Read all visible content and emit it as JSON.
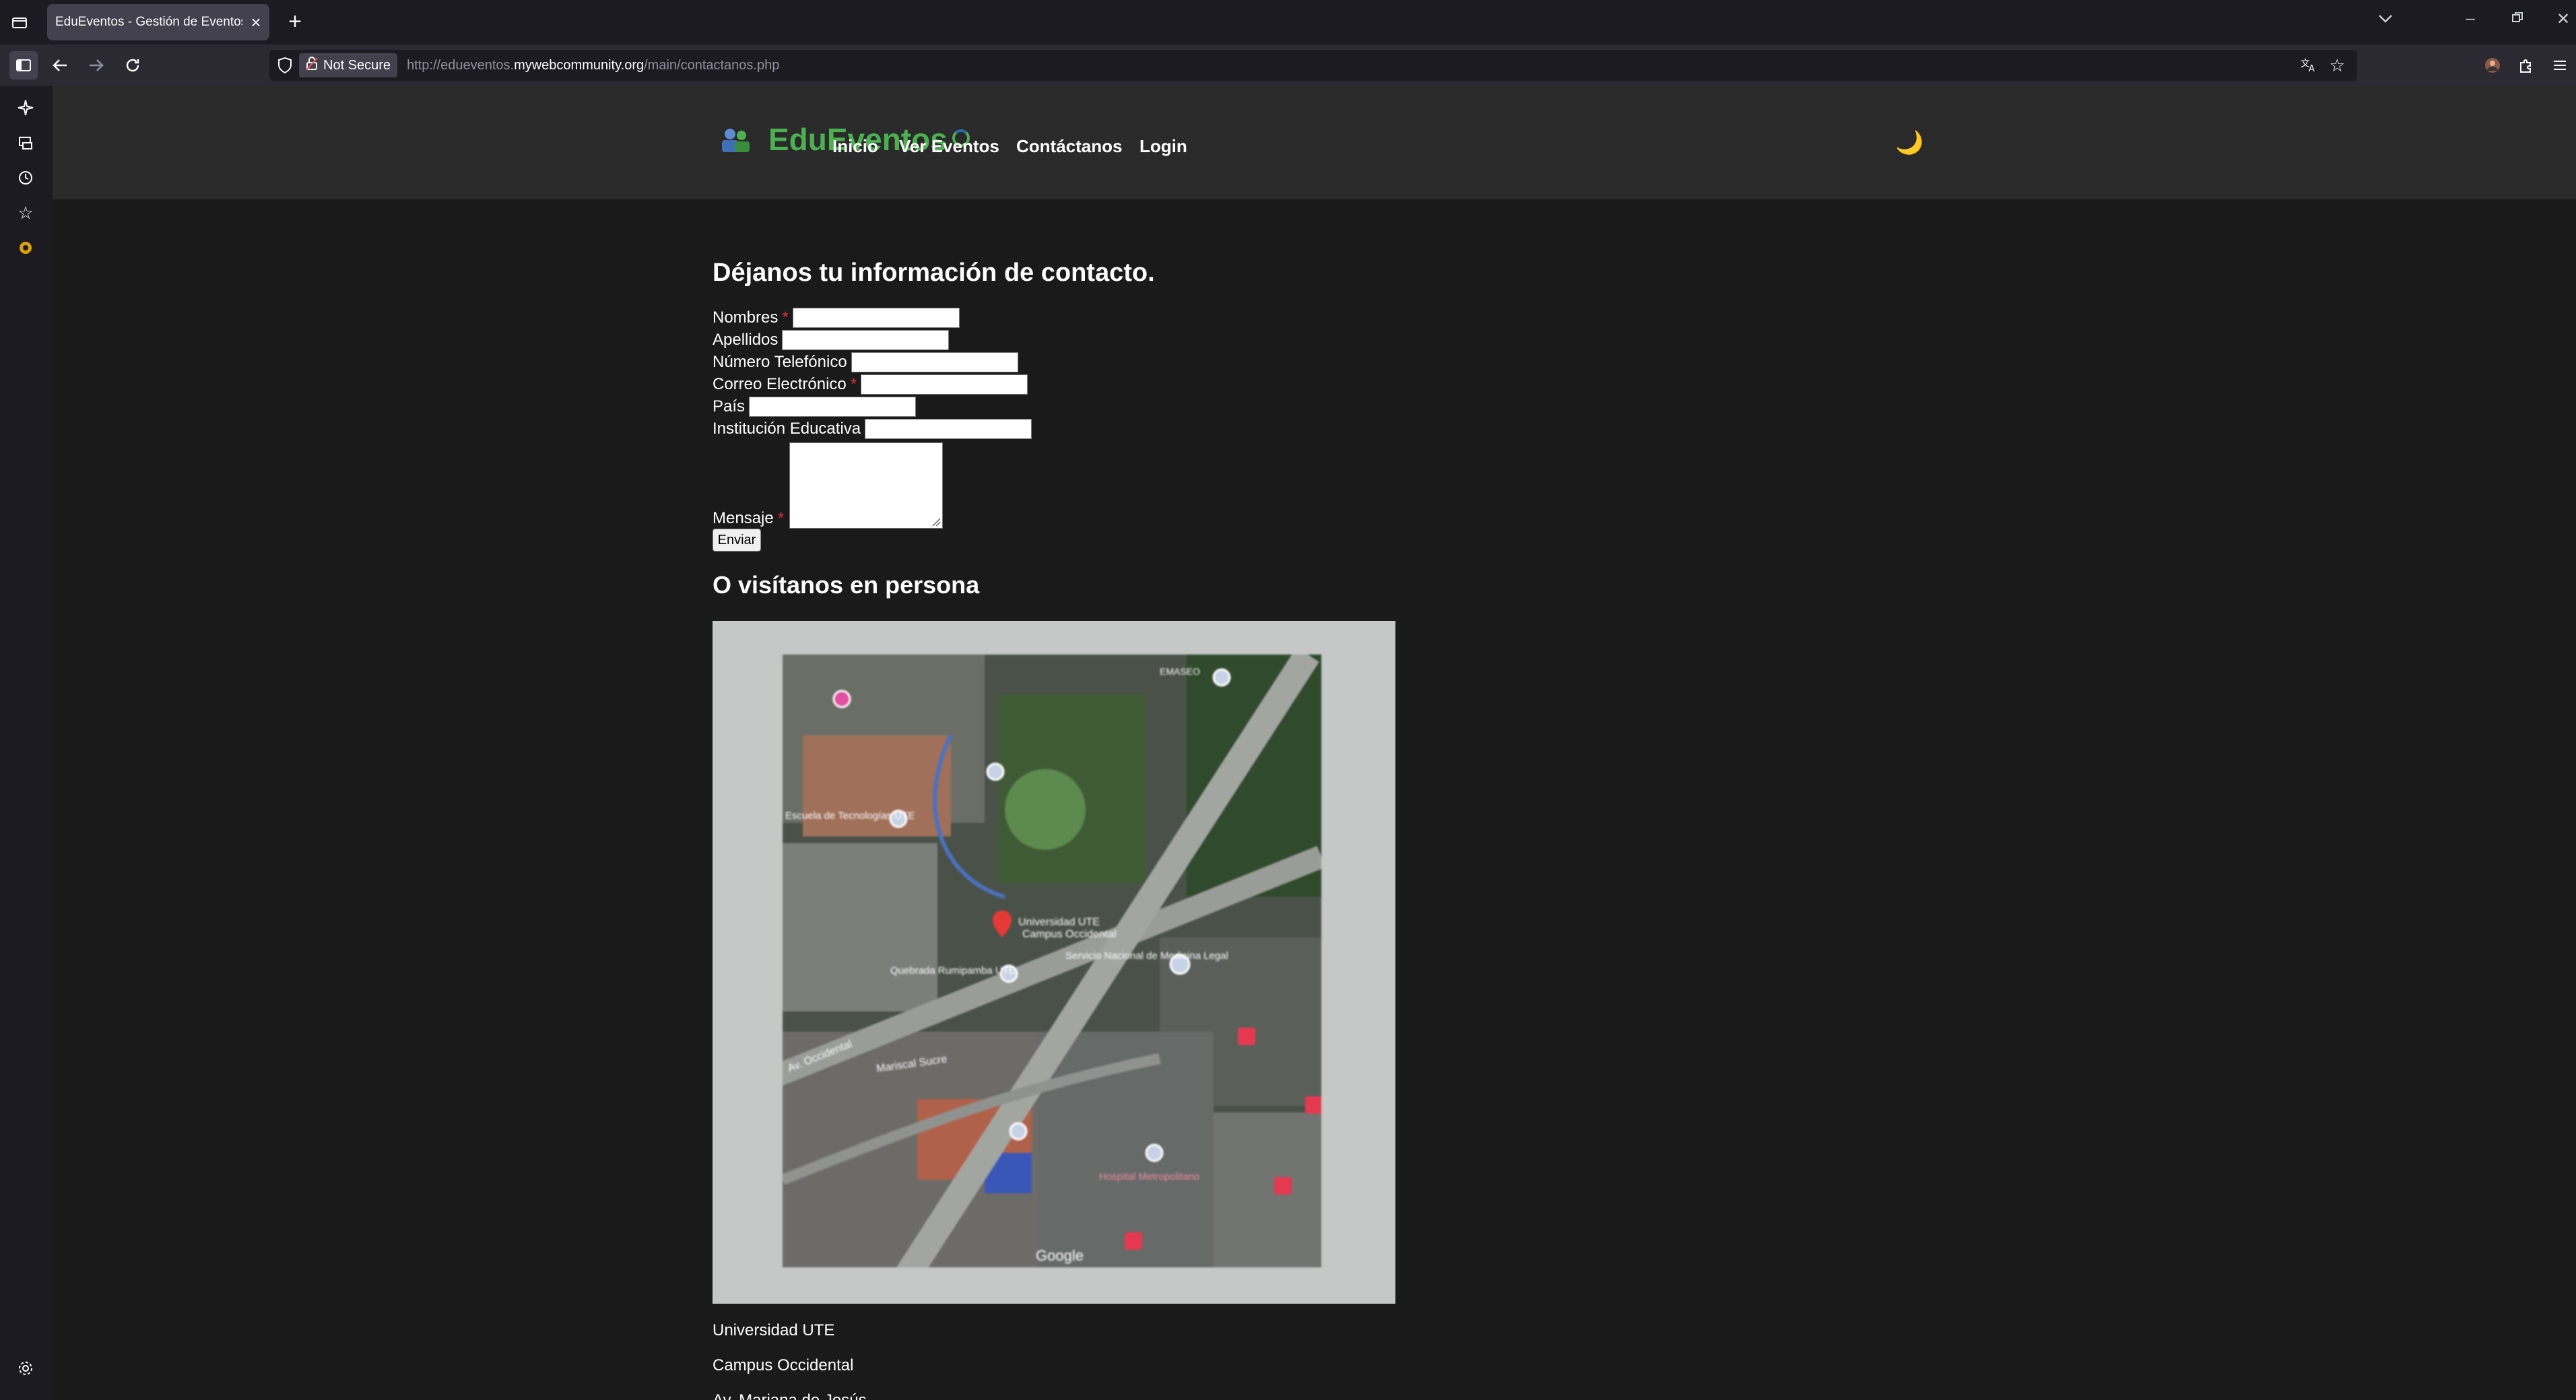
{
  "browser": {
    "tab_title": "EduEventos - Gestión de Eventos",
    "security_label": "Not Secure",
    "url_prefix": "http://edueventos.",
    "url_domain": "mywebcommunity.org",
    "url_path": "/main/contactanos.php"
  },
  "site": {
    "brand": "EduEventos",
    "nav": [
      "Inicio",
      "Ver Eventos",
      "Contáctanos",
      "Login"
    ],
    "theme_toggle": "🌙",
    "accent_color": "#4caf50"
  },
  "form": {
    "title": "Déjanos tu información de contacto.",
    "required_mark": "*",
    "fields": {
      "nombres": "Nombres",
      "apellidos": "Apellidos",
      "telefono": "Número Telefónico",
      "correo": "Correo Electrónico",
      "pais": "País",
      "institucion": "Institución Educativa",
      "mensaje": "Mensaje"
    },
    "submit": "Enviar"
  },
  "visit": {
    "heading": "O visítanos en persona",
    "map_labels": {
      "universidad": "Universidad UTE",
      "campus": "Campus Occidental",
      "escuela": "Escuela de Tecnologías UTE",
      "servicio": "Servicio Nacional de Medicina Legal",
      "quebrada": "Quebrada Rumipamba UTE",
      "av_occidental": "Av. Occidental",
      "mariscal": "Mariscal Sucre",
      "emaseo": "EMASEO",
      "hospital": "Hospital Metropolitano",
      "google": "Google"
    },
    "address": [
      "Universidad UTE",
      "Campus Occidental",
      "Av. Mariana de Jesús"
    ]
  }
}
